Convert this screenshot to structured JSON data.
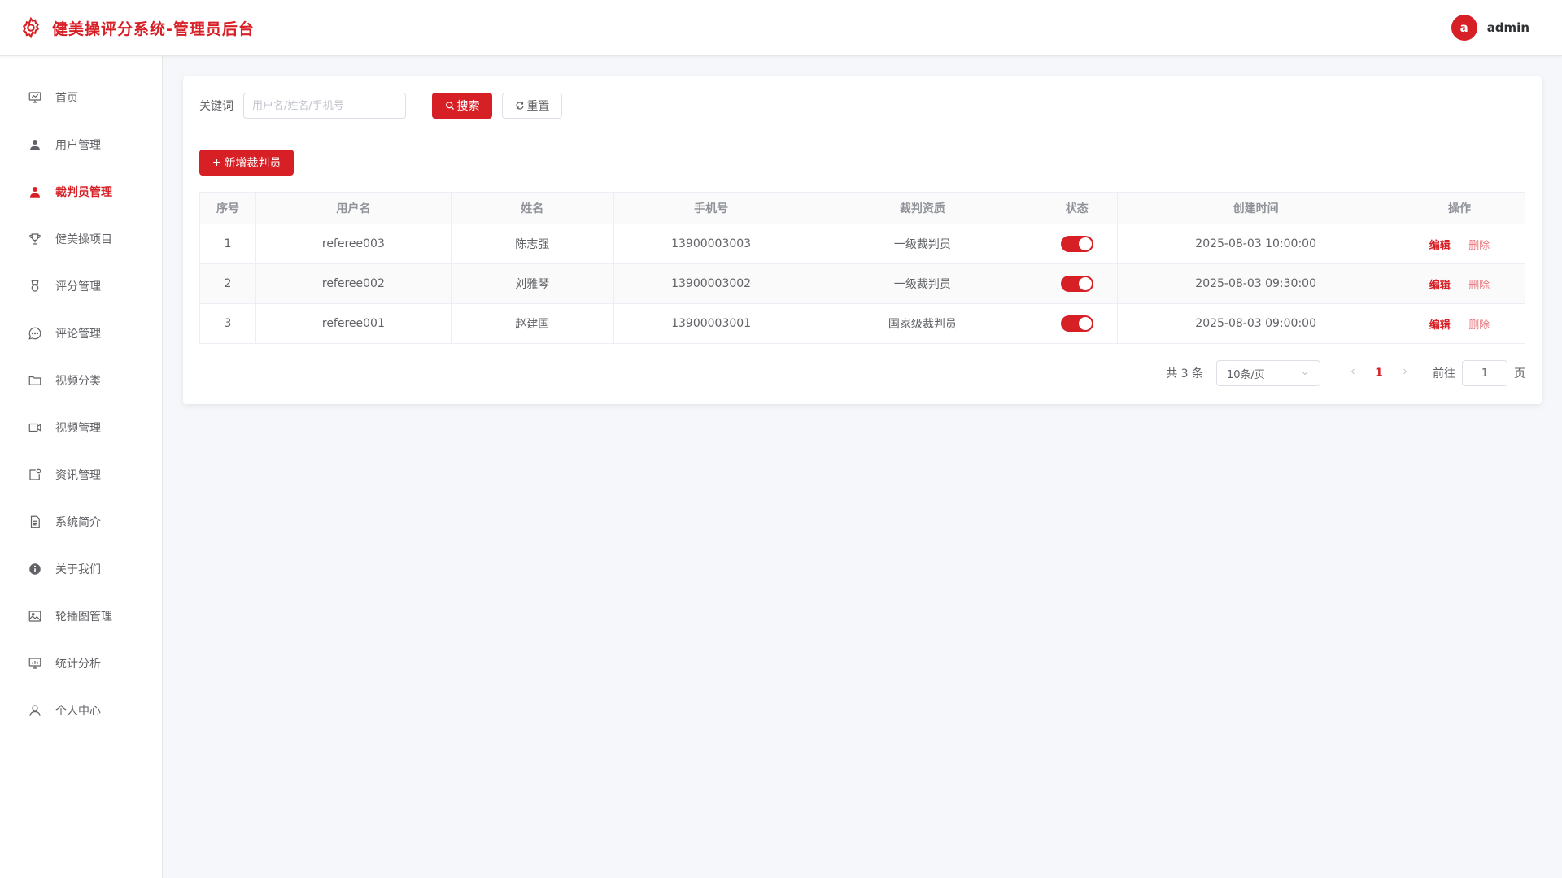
{
  "header": {
    "title": "健美操评分系统-管理员后台",
    "avatar_letter": "a",
    "username": "admin",
    "accent_color": "#d71f26"
  },
  "sidebar": {
    "items": [
      {
        "label": "首页",
        "icon": "presentation-board-icon"
      },
      {
        "label": "用户管理",
        "icon": "user-icon"
      },
      {
        "label": "裁判员管理",
        "icon": "referee-user-icon",
        "active": true
      },
      {
        "label": "健美操项目",
        "icon": "trophy-icon"
      },
      {
        "label": "评分管理",
        "icon": "medal-icon"
      },
      {
        "label": "评论管理",
        "icon": "chat-icon"
      },
      {
        "label": "视频分类",
        "icon": "folder-icon"
      },
      {
        "label": "视频管理",
        "icon": "video-camera-icon"
      },
      {
        "label": "资讯管理",
        "icon": "news-icon"
      },
      {
        "label": "系统简介",
        "icon": "document-icon"
      },
      {
        "label": "关于我们",
        "icon": "info-icon"
      },
      {
        "label": "轮播图管理",
        "icon": "picture-icon"
      },
      {
        "label": "统计分析",
        "icon": "chart-board-icon"
      },
      {
        "label": "个人中心",
        "icon": "person-outline-icon"
      }
    ]
  },
  "search": {
    "label": "关键词",
    "placeholder": "用户名/姓名/手机号",
    "value": "",
    "search_label": "搜索",
    "reset_label": "重置"
  },
  "actions": {
    "add_label": "新增裁判员"
  },
  "table": {
    "columns": [
      "序号",
      "用户名",
      "姓名",
      "手机号",
      "裁判资质",
      "状态",
      "创建时间",
      "操作"
    ],
    "rows": [
      {
        "index": "1",
        "username": "referee003",
        "name": "陈志强",
        "phone": "13900003003",
        "qualification": "一级裁判员",
        "enabled": true,
        "created": "2025-08-03 10:00:00"
      },
      {
        "index": "2",
        "username": "referee002",
        "name": "刘雅琴",
        "phone": "13900003002",
        "qualification": "一级裁判员",
        "enabled": true,
        "created": "2025-08-03 09:30:00"
      },
      {
        "index": "3",
        "username": "referee001",
        "name": "赵建国",
        "phone": "13900003001",
        "qualification": "国家级裁判员",
        "enabled": true,
        "created": "2025-08-03 09:00:00"
      }
    ],
    "edit_label": "编辑",
    "delete_label": "删除"
  },
  "pagination": {
    "total_text": "共 3 条",
    "page_size": "10条/页",
    "current_page": "1",
    "goto_label": "前往",
    "goto_value": "1",
    "goto_suffix": "页"
  }
}
